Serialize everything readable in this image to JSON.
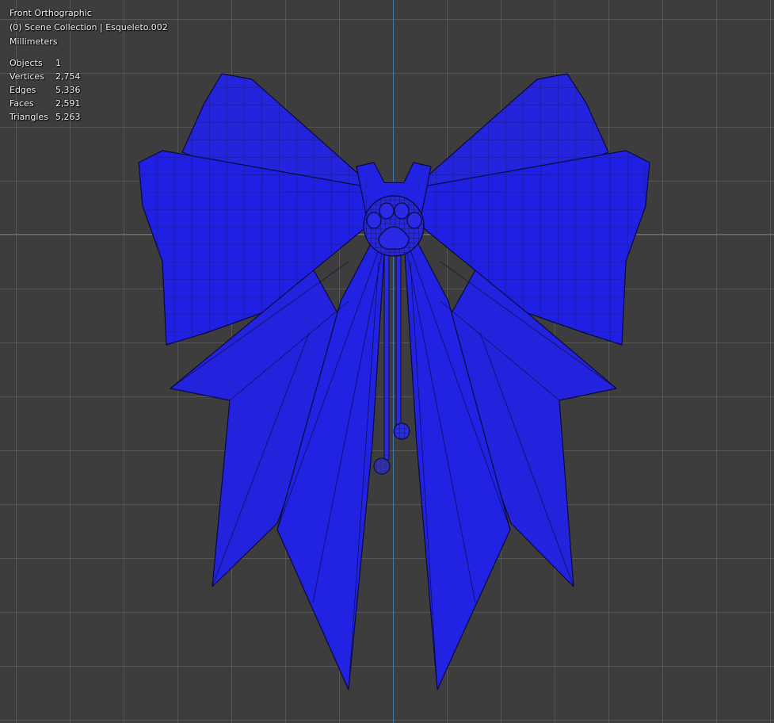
{
  "viewport": {
    "view_name": "Front Orthographic",
    "collection": "(0) Scene Collection | Esqueleto.002",
    "units": "Millimeters",
    "stats": [
      {
        "label": "Objects",
        "value": "1"
      },
      {
        "label": "Vertices",
        "value": "2,754"
      },
      {
        "label": "Edges",
        "value": "5,336"
      },
      {
        "label": "Faces",
        "value": "2,591"
      },
      {
        "label": "Triangles",
        "value": "5,263"
      }
    ]
  },
  "colors": {
    "background": "#3d3d3d",
    "grid": "#5a5a5a",
    "x_axis": "#c44848",
    "z_axis": "#3f78b8",
    "mesh_fill": "#2020e0",
    "wire": "#0a0a3a"
  },
  "model": {
    "icon": "bow-mesh-icon",
    "center_icon": "paw-print-icon"
  }
}
